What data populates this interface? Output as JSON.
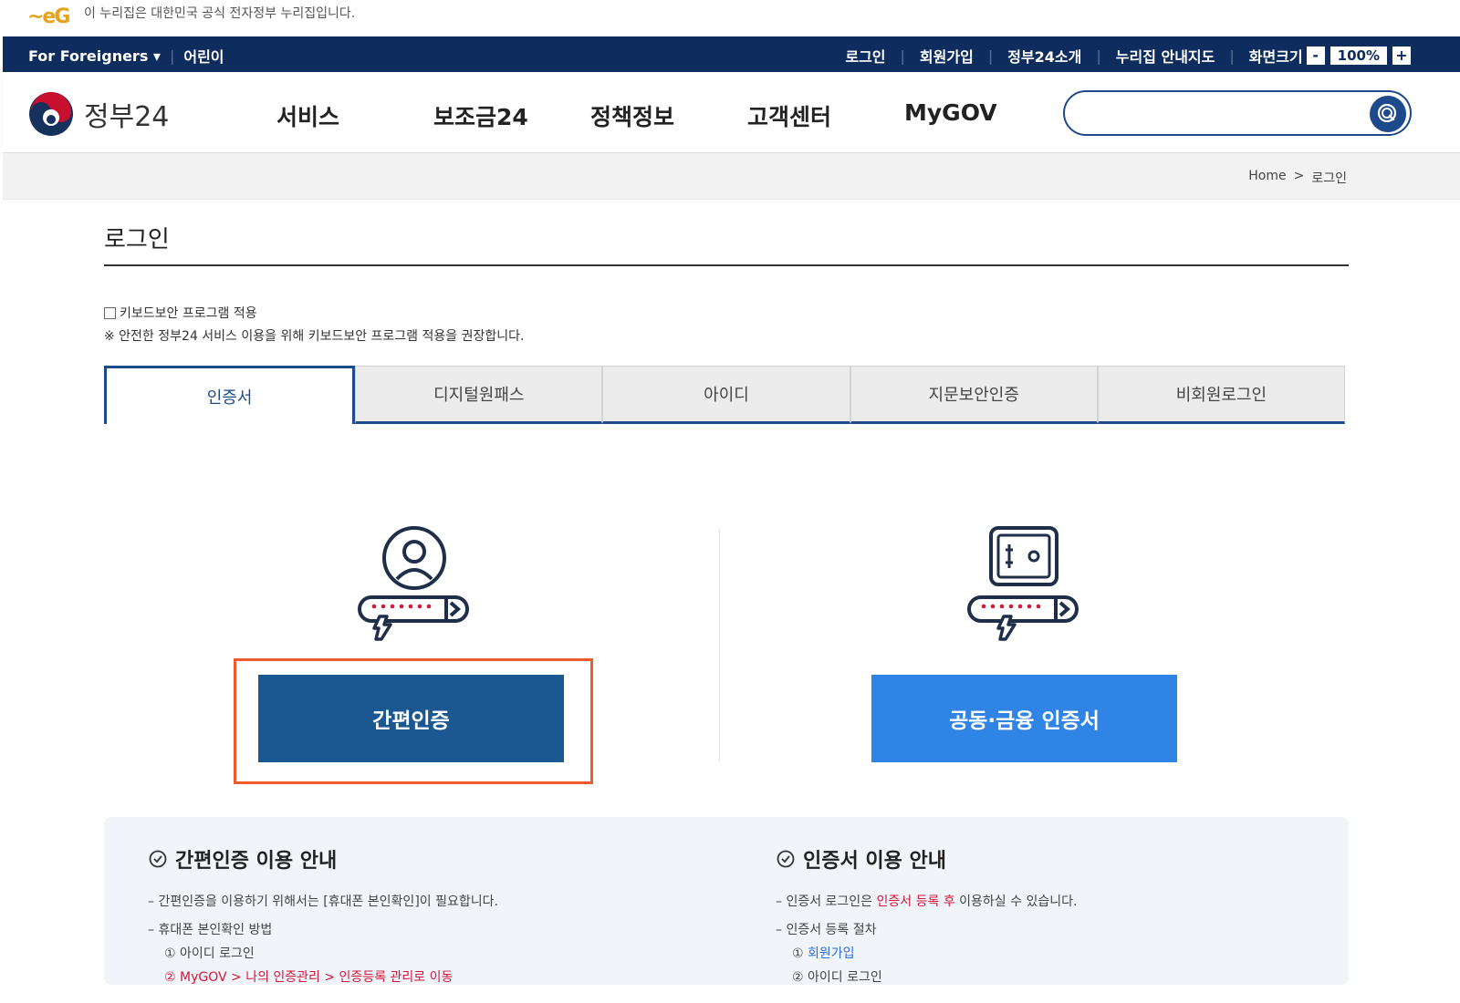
{
  "gov_notice": {
    "text": "이 누리집은 대한민국 공식 전자정부 누리집입니다."
  },
  "topbar": {
    "foreigners": "For Foreigners ▾",
    "kids": "어린이",
    "login": "로그인",
    "signup": "회원가입",
    "about": "정부24소개",
    "sitemap": "누리집 안내지도",
    "screen_size": "화면크기",
    "zoom_minus": "-",
    "zoom_value": "100%",
    "zoom_plus": "+"
  },
  "header": {
    "logo_text": "정부24",
    "menu": [
      "서비스",
      "보조금24",
      "정책정보",
      "고객센터",
      "MyGOV"
    ],
    "search_placeholder": ""
  },
  "breadcrumb": {
    "home": "Home",
    "sep": ">",
    "current": "로그인"
  },
  "page": {
    "title": "로그인",
    "keyboard_label": "키보드보안 프로그램 적용",
    "keyboard_note": "※ 안전한 정부24 서비스 이용을 위해 키보드보안 프로그램 적용을 권장합니다."
  },
  "tabs": [
    "인증서",
    "디지털원패스",
    "아이디",
    "지문보안인증",
    "비회원로그인"
  ],
  "auth": {
    "simple_button": "간편인증",
    "cert_button": "공동·금융 인증서"
  },
  "guide": {
    "left_title": "간편인증 이용 안내",
    "left_item1": "간편인증을 이용하기 위해서는 [휴대폰 본인확인]이 필요합니다.",
    "left_item2": "휴대폰 본인확인 방법",
    "left_sub1": "① 아이디 로그인",
    "left_sub2": "② MyGOV > 나의 인증관리 > 인증등록 관리로 이동",
    "right_title": "인증서 이용 안내",
    "right_item1_a": "인증서 로그인은 ",
    "right_item1_b": "인증서 등록 후",
    "right_item1_c": " 이용하실 수 있습니다.",
    "right_item2": "인증서 등록 절차",
    "right_sub1_a": "① ",
    "right_sub1_b": "회원가입",
    "right_sub2": "② 아이디 로그인"
  },
  "colors": {
    "navy": "#0e2d5e",
    "primary": "#1b5791",
    "cert_button": "#2f84e5",
    "highlight": "#ef5b2f",
    "accent_red": "#d4183a"
  }
}
